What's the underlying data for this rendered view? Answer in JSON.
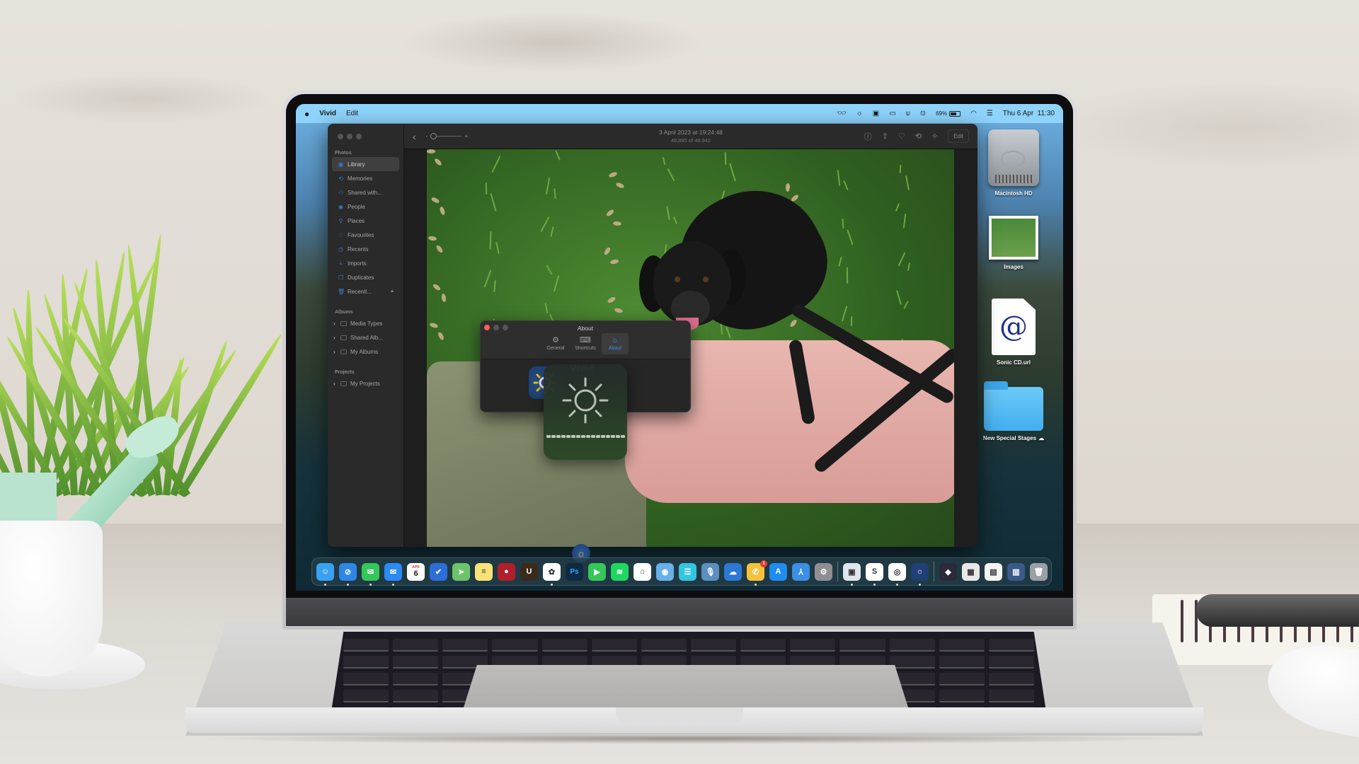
{
  "menubar": {
    "apple_icon": "apple-icon",
    "app_name": "Vivid",
    "menus": [
      "Edit"
    ],
    "status_icons": [
      "glasses-icon",
      "brightness-icon",
      "wallet-icon",
      "display-icon",
      "airpods-icon",
      "play-icon"
    ],
    "battery_percent": "69%",
    "battery_level": 0.69,
    "right_icons": [
      "wifi-icon",
      "control-center-icon"
    ],
    "datetime": "Thu 6 Apr  11:30"
  },
  "photos_window": {
    "sidebar": {
      "sections": [
        {
          "title": "Photos",
          "items": [
            {
              "label": "Library",
              "icon": "library-icon",
              "active": true
            },
            {
              "label": "Memories",
              "icon": "memories-icon"
            },
            {
              "label": "Shared with...",
              "icon": "shared-with-you-icon"
            },
            {
              "label": "People",
              "icon": "people-icon"
            },
            {
              "label": "Places",
              "icon": "places-icon"
            },
            {
              "label": "Favourites",
              "icon": "heart-icon"
            },
            {
              "label": "Recents",
              "icon": "clock-icon"
            },
            {
              "label": "Imports",
              "icon": "import-icon"
            },
            {
              "label": "Duplicates",
              "icon": "duplicates-icon"
            },
            {
              "label": "Recentl...",
              "icon": "trash-icon",
              "locked": true
            }
          ]
        },
        {
          "title": "Albums",
          "items": [
            {
              "label": "Media Types",
              "icon": "folder-icon"
            },
            {
              "label": "Shared Alb...",
              "icon": "shared-folder-icon"
            },
            {
              "label": "My Albums",
              "icon": "folder-icon"
            }
          ]
        },
        {
          "title": "Projects",
          "items": [
            {
              "label": "My Projects",
              "icon": "folder-icon"
            }
          ]
        }
      ]
    },
    "toolbar": {
      "zoom_minus": "-",
      "zoom_plus": "+",
      "zoom_level": 0.0,
      "title": "3 April 2023 at 19:24:48",
      "subtitle": "48,895 of 48,942",
      "actions": [
        "info-icon",
        "share-icon",
        "favourite-icon",
        "rotate-icon",
        "enhance-icon"
      ],
      "edit_label": "Edit"
    }
  },
  "about_window": {
    "title": "About",
    "tabs": [
      {
        "label": "General",
        "icon": "gears-icon",
        "active": false
      },
      {
        "label": "Shortcuts",
        "icon": "keyboard-icon",
        "active": false
      },
      {
        "label": "About",
        "icon": "sun-icon",
        "active": true
      }
    ],
    "app_name": "Vivid"
  },
  "brightness_hud": {
    "icon": "brightness-icon",
    "level": 1.0,
    "segments": 16
  },
  "desktop_icons": [
    {
      "label": "Macintosh HD",
      "type": "drive"
    },
    {
      "label": "Images",
      "type": "image-stack"
    },
    {
      "label": "Sonic CD.url",
      "type": "url-file"
    },
    {
      "label": "New Special Stages",
      "type": "folder",
      "cloud": true
    }
  ],
  "dock": {
    "apps": [
      {
        "name": "Finder",
        "color": "#3aa0f0",
        "glyph": "☺",
        "running": true
      },
      {
        "name": "Safari",
        "color": "#2e86e6",
        "glyph": "⊘",
        "running": true
      },
      {
        "name": "Messages",
        "color": "#35c759",
        "glyph": "✉",
        "running": true
      },
      {
        "name": "Mail",
        "color": "#2b8af5",
        "glyph": "✉",
        "running": true
      },
      {
        "name": "Calendar",
        "color": "#ffffff",
        "glyph": "6",
        "month": "APR",
        "running": false
      },
      {
        "name": "Reminders",
        "color": "#2b6fd6",
        "glyph": "✔",
        "running": false
      },
      {
        "name": "Maps",
        "color": "#6cc46a",
        "glyph": "➤",
        "running": false
      },
      {
        "name": "Notes",
        "color": "#f8e27a",
        "glyph": "≡",
        "running": false
      },
      {
        "name": "Joystick App",
        "color": "#b01f2a",
        "glyph": "●",
        "running": false
      },
      {
        "name": "Unreal Tournament",
        "color": "#3a2a1a",
        "glyph": "U",
        "running": false
      },
      {
        "name": "Photos",
        "color": "#ffffff",
        "glyph": "✿",
        "running": true
      },
      {
        "name": "Photoshop",
        "color": "#0e2a44",
        "glyph": "Ps",
        "running": false
      },
      {
        "name": "FaceTime",
        "color": "#34c759",
        "glyph": "▶",
        "running": false
      },
      {
        "name": "Spotify",
        "color": "#1ed760",
        "glyph": "≋",
        "running": false
      },
      {
        "name": "Home",
        "color": "#ffffff",
        "glyph": "⌂",
        "running": false
      },
      {
        "name": "Quick Note App",
        "color": "#6ab0e8",
        "glyph": "◉",
        "running": false
      },
      {
        "name": "Flashcards App",
        "color": "#33c6e0",
        "glyph": "☰",
        "running": false
      },
      {
        "name": "Dictation App",
        "color": "#5c8fc0",
        "glyph": "🎙",
        "running": false
      },
      {
        "name": "Weather",
        "color": "#2c78d4",
        "glyph": "☁",
        "running": false
      },
      {
        "name": "WhatsApp",
        "color": "#f5c33b",
        "glyph": "✆",
        "running": true,
        "badge": "1"
      },
      {
        "name": "App Store",
        "color": "#1f8cf0",
        "glyph": "A",
        "running": false
      },
      {
        "name": "Tripod App",
        "color": "#3b8fe4",
        "glyph": "⅄",
        "running": false
      },
      {
        "name": "System Settings",
        "color": "#8e8e93",
        "glyph": "⚙",
        "running": false
      }
    ],
    "recent_apps": [
      {
        "name": "Preview",
        "color": "#dfe6ee",
        "glyph": "▣",
        "running": true
      },
      {
        "name": "Scrivener",
        "color": "#ffffff",
        "glyph": "S",
        "running": true
      },
      {
        "name": "Chrome",
        "color": "#ffffff",
        "glyph": "◎",
        "running": true
      },
      {
        "name": "Vivid",
        "color": "#1f3f75",
        "glyph": "☼",
        "running": true
      }
    ],
    "documents": [
      {
        "name": "Reality Composer",
        "color": "#2a2a3a",
        "glyph": "◆"
      },
      {
        "name": "Screenshot 1",
        "color": "#e8e8e8",
        "glyph": "▦"
      },
      {
        "name": "Screenshot 2",
        "color": "#f4f4f4",
        "glyph": "▤"
      },
      {
        "name": "Screenshot 3",
        "color": "#3a5a8a",
        "glyph": "▥"
      },
      {
        "name": "Trash",
        "color": "#9aa0a6",
        "glyph": "🗑"
      }
    ]
  },
  "colors": {
    "menubar_bg": "#8dd3fb",
    "accent_blue": "#2d8ef0",
    "close_red": "#ff5f57",
    "badge_red": "#e93a30"
  }
}
